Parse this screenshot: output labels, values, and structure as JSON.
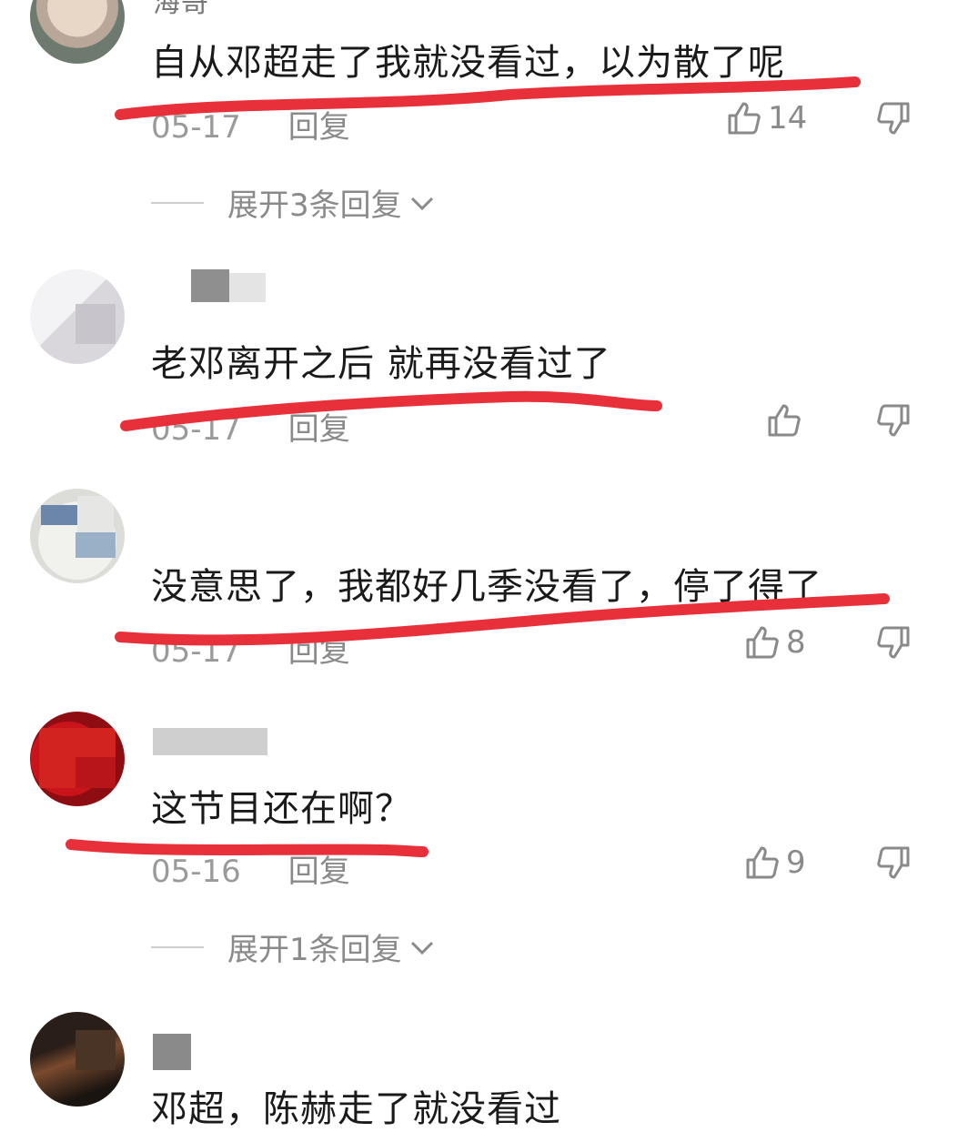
{
  "comments": [
    {
      "username": "海哥",
      "text": "自从邓超走了我就没看过，以为散了呢",
      "date": "05-17",
      "reply_label": "回复",
      "likes": "14",
      "expand_label": "展开3条回复"
    },
    {
      "username": "",
      "text": "老邓离开之后 就再没看过了",
      "date": "05-17",
      "reply_label": "回复",
      "likes": ""
    },
    {
      "username": "",
      "text": "没意思了，我都好几季没看了，停了得了",
      "date": "05-17",
      "reply_label": "回复",
      "likes": "8"
    },
    {
      "username": "",
      "text": "这节目还在啊？",
      "date": "05-16",
      "reply_label": "回复",
      "likes": "9",
      "expand_label": "展开1条回复"
    },
    {
      "username": "",
      "text": "邓超，陈赫走了就没看过"
    }
  ],
  "colors": {
    "underline": "#e8303a",
    "meta": "#9a9a9a",
    "text": "#1a1a1a"
  }
}
